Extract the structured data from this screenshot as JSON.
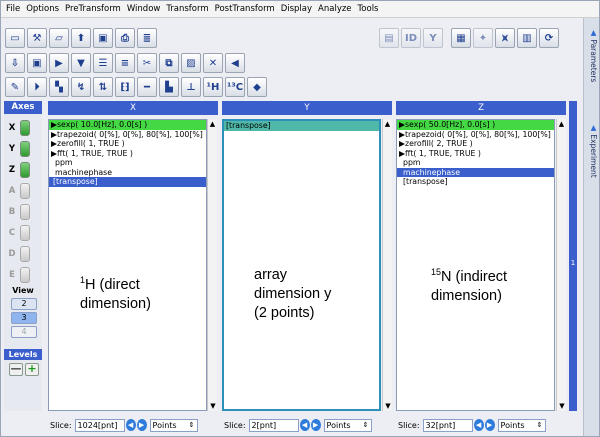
{
  "menu": [
    "File",
    "Options",
    "PreTransform",
    "Window",
    "Transform",
    "PostTransform",
    "Display",
    "Analyze",
    "Tools"
  ],
  "toolbar": {
    "text_buttons": {
      "h1": "¹H",
      "c13": "¹³C"
    }
  },
  "axes": {
    "header": "Axes",
    "rows": [
      {
        "label": "X",
        "enabled": true
      },
      {
        "label": "Y",
        "enabled": true
      },
      {
        "label": "Z",
        "enabled": true
      },
      {
        "label": "A",
        "enabled": false
      },
      {
        "label": "B",
        "enabled": false
      },
      {
        "label": "C",
        "enabled": false
      },
      {
        "label": "D",
        "enabled": false
      },
      {
        "label": "E",
        "enabled": false
      }
    ],
    "view_label": "View",
    "view_buttons": [
      "2",
      "3",
      "4"
    ],
    "active_view": "3",
    "levels_header": "Levels",
    "levels_minus": "—",
    "levels_plus": "+"
  },
  "columns": [
    {
      "header": "X",
      "commands": [
        {
          "text": "▶sexp( 10.0[Hz], 0.0[s] )",
          "style": "green"
        },
        {
          "text": "▶trapezoid( 0[%], 0[%], 80[%], 100[%] )",
          "style": "plain"
        },
        {
          "text": "▶zerofill( 1, TRUE )",
          "style": "plain"
        },
        {
          "text": "▶fft( 1, TRUE, TRUE )",
          "style": "plain"
        },
        {
          "text": "ppm",
          "style": "indent"
        },
        {
          "text": "machinephase",
          "style": "indent"
        },
        {
          "text": "[transpose]",
          "style": "blue"
        }
      ],
      "caption_line1_sup": "1",
      "caption_line1": "H (direct",
      "caption_line2": "dimension)",
      "slice_label": "Slice:",
      "slice_value": "1024[pnt]",
      "unit": "Points"
    },
    {
      "header": "Y",
      "commands": [
        {
          "text": "[transpose]",
          "style": "teal"
        }
      ],
      "caption_line1": "array",
      "caption_line2": "dimension y",
      "caption_line3": "(2 points)",
      "slice_label": "Slice:",
      "slice_value": "2[pnt]",
      "unit": "Points"
    },
    {
      "header": "Z",
      "commands": [
        {
          "text": "▶sexp( 50.0[Hz], 0.0[s] )",
          "style": "green"
        },
        {
          "text": "▶trapezoid( 0[%], 0[%], 80[%], 100[%] )",
          "style": "plain"
        },
        {
          "text": "▶zerofill( 2, TRUE )",
          "style": "plain"
        },
        {
          "text": "▶fft( 1, TRUE, TRUE )",
          "style": "plain"
        },
        {
          "text": "ppm",
          "style": "indent"
        },
        {
          "text": "machinephase",
          "style": "blue"
        },
        {
          "text": "[transpose]",
          "style": "indent"
        }
      ],
      "caption_line1_sup": "15",
      "caption_line1": "N (indirect",
      "caption_line2": "dimension)",
      "slice_label": "Slice:",
      "slice_value": "32[pnt]",
      "unit": "Points"
    }
  ],
  "right_strip_label": "1",
  "side_tabs": [
    "Parameters",
    "Experiment"
  ],
  "colors": {
    "header_blue": "#3a5fcd",
    "active_green": "#44d844",
    "selected_teal": "#4fb8a8"
  }
}
